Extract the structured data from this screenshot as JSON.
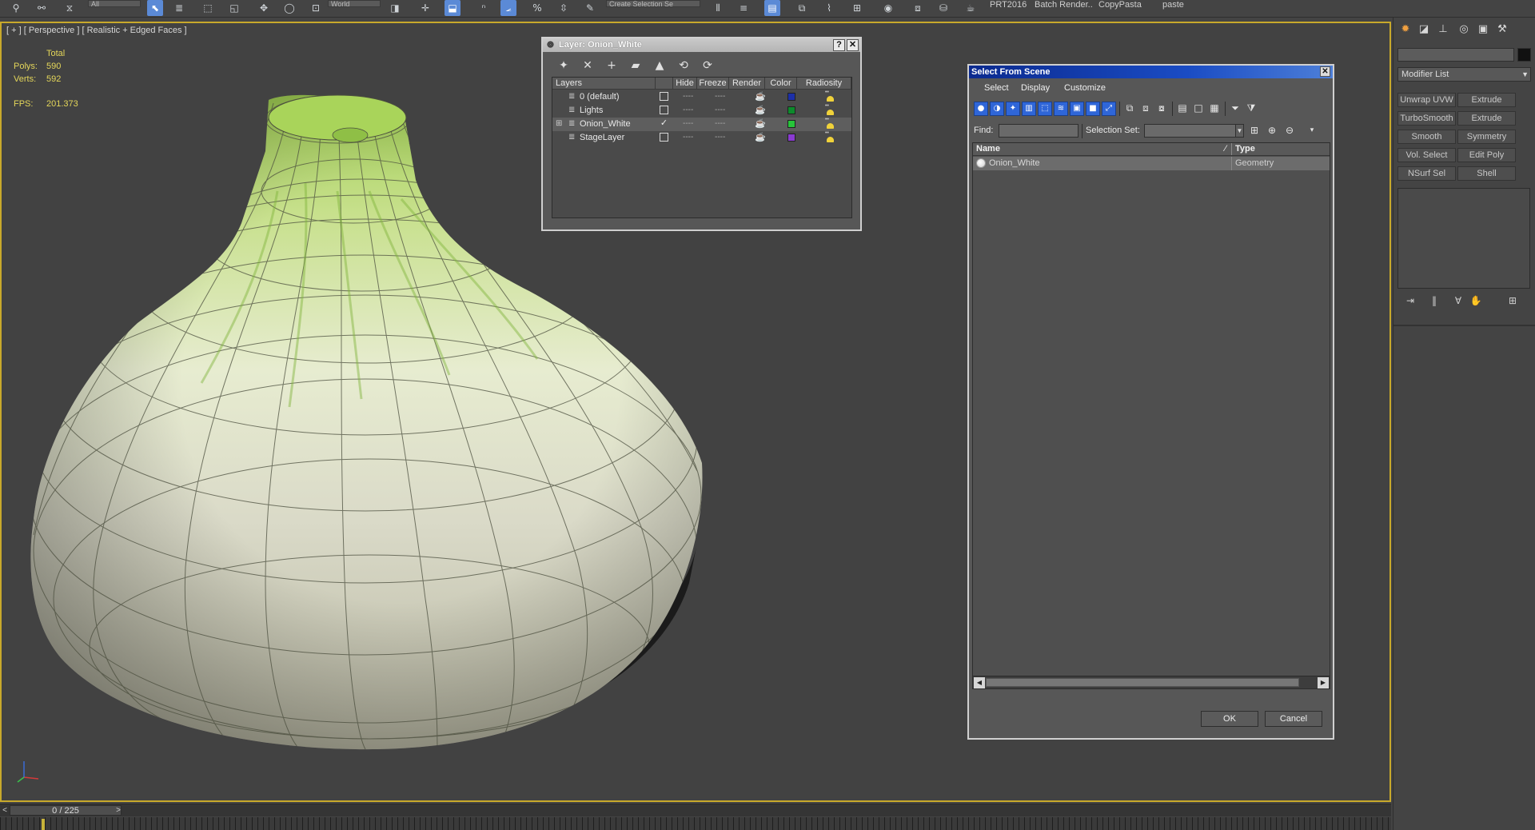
{
  "toolbar": {
    "selection_filter": "All",
    "ref_coord": "World",
    "named_selection": "Create Selection Se",
    "labels": [
      "PRT2016",
      "Batch Render..",
      "CopyPasta",
      "paste"
    ]
  },
  "viewport": {
    "label": "[ + ] [ Perspective ] [ Realistic + Edged Faces ]",
    "stats": {
      "total_label": "Total",
      "polys_label": "Polys:",
      "polys_value": "590",
      "verts_label": "Verts:",
      "verts_value": "592",
      "fps_label": "FPS:",
      "fps_value": "201.373"
    },
    "axis": {
      "x": "x",
      "y": "y",
      "z": "z"
    }
  },
  "timeline": {
    "position": "0 / 225",
    "prev": "<",
    "next": ">"
  },
  "command_panel": {
    "modifier_list_label": "Modifier List",
    "modifier_buttons": [
      "Unwrap UVW",
      "Extrude",
      "TurboSmooth",
      "Extrude",
      "Smooth",
      "Symmetry",
      "Vol. Select",
      "Edit Poly",
      "NSurf Sel",
      "Shell"
    ]
  },
  "layer_dialog": {
    "title": "Layer: Onion_White",
    "help_label": "?",
    "close_label": "✕",
    "columns": [
      "Layers",
      "Hide",
      "Freeze",
      "Render",
      "Color",
      "Radiosity"
    ],
    "rows": [
      {
        "name": "0 (default)",
        "current": false,
        "color": "#1c2fa8"
      },
      {
        "name": "Lights",
        "current": false,
        "color": "#0d8a2c"
      },
      {
        "name": "Onion_White",
        "current": true,
        "color": "#27c53a"
      },
      {
        "name": "StageLayer",
        "current": false,
        "color": "#8a3bd1"
      }
    ],
    "dash": "----",
    "render_glyph": "☕",
    "current_mark": "✓",
    "expand_mark": "⊞"
  },
  "select_from_scene": {
    "title": "Select From Scene",
    "close_label": "✕",
    "menus": [
      "Select",
      "Display",
      "Customize"
    ],
    "find_label": "Find:",
    "selection_set_label": "Selection Set:",
    "columns": [
      "Name",
      "Type"
    ],
    "sort_glyph": "⁄",
    "rows": [
      {
        "name": "Onion_White",
        "type": "Geometry"
      }
    ],
    "ok_label": "OK",
    "cancel_label": "Cancel"
  }
}
